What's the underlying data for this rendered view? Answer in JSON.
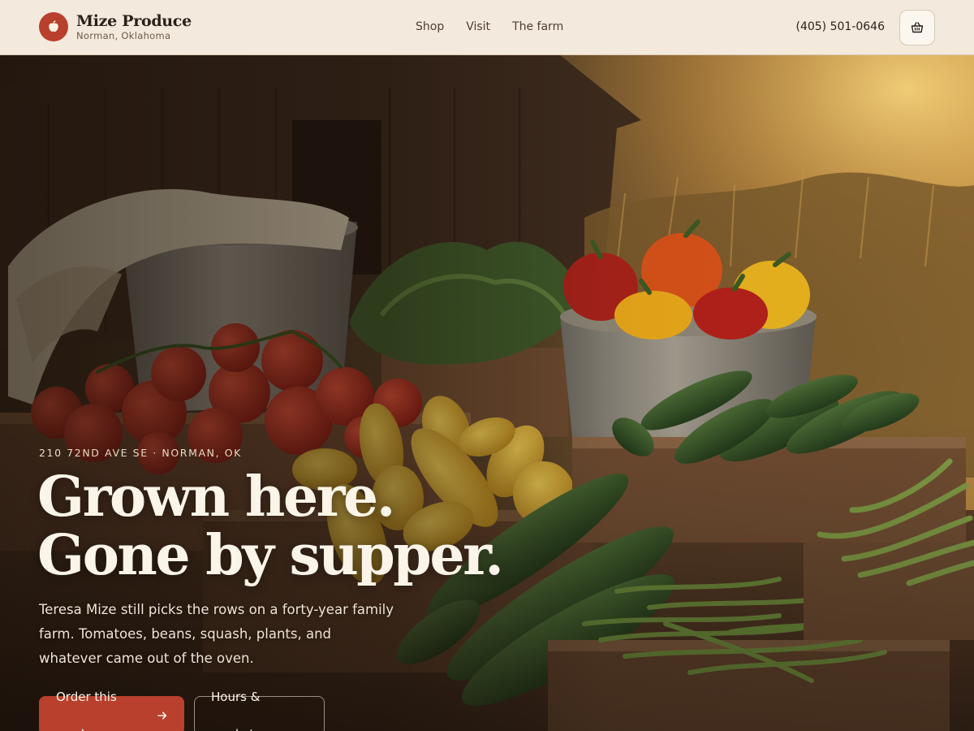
{
  "brand": {
    "name": "Mize Produce",
    "location": "Norman, Oklahoma",
    "logo_icon": "apple-icon",
    "accent_color": "#b8402c"
  },
  "nav": {
    "items": [
      {
        "label": "Shop"
      },
      {
        "label": "Visit"
      },
      {
        "label": "The farm"
      }
    ]
  },
  "header": {
    "phone": "(405) 501-0646",
    "cart_icon": "basket-icon"
  },
  "hero": {
    "address": "210 72ND AVE SE · NORMAN, OK",
    "headline_line1": "Grown here.",
    "headline_line2": "Gone by supper.",
    "lead": "Teresa Mize still picks the rows on a forty-year family farm. Tomatoes, beans, squash, plants, and whatever came out of the oven.",
    "primary_button": "Order this week",
    "primary_button_icon": "arrow-right-icon",
    "secondary_button": "Hours & markets"
  }
}
